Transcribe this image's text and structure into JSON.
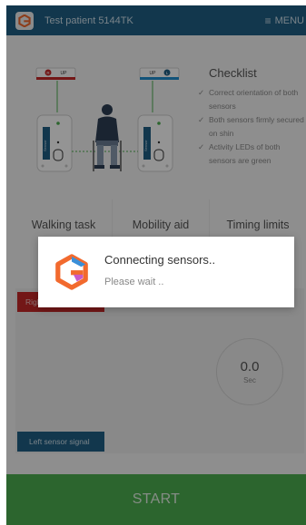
{
  "header": {
    "title": "Test patient 5144TK",
    "menu_label": "MENU"
  },
  "illustration": {
    "right_tag": "R",
    "left_tag": "L",
    "up_label": "UP",
    "sensor_label": "Sensor"
  },
  "checklist": {
    "title": "Checklist",
    "items": [
      "Correct orientation of both sensors",
      "Both sensors firmly secured on shin",
      "Activity LEDs of both sensors are green"
    ]
  },
  "tasks": [
    {
      "label": "Walking task"
    },
    {
      "label": "Mobility aid"
    },
    {
      "label": "Timing limits"
    }
  ],
  "signals": {
    "right_label": "Right sensor signal",
    "left_label": "Left sensor signal",
    "timer_value": "0.0",
    "timer_unit": "Sec"
  },
  "start_label": "START",
  "dialog": {
    "title": "Connecting sensors..",
    "message": "Please wait .."
  },
  "colors": {
    "header": "#1f5f86",
    "right_signal": "#c62828",
    "left_signal": "#1f5f86",
    "start": "#4caf50"
  }
}
